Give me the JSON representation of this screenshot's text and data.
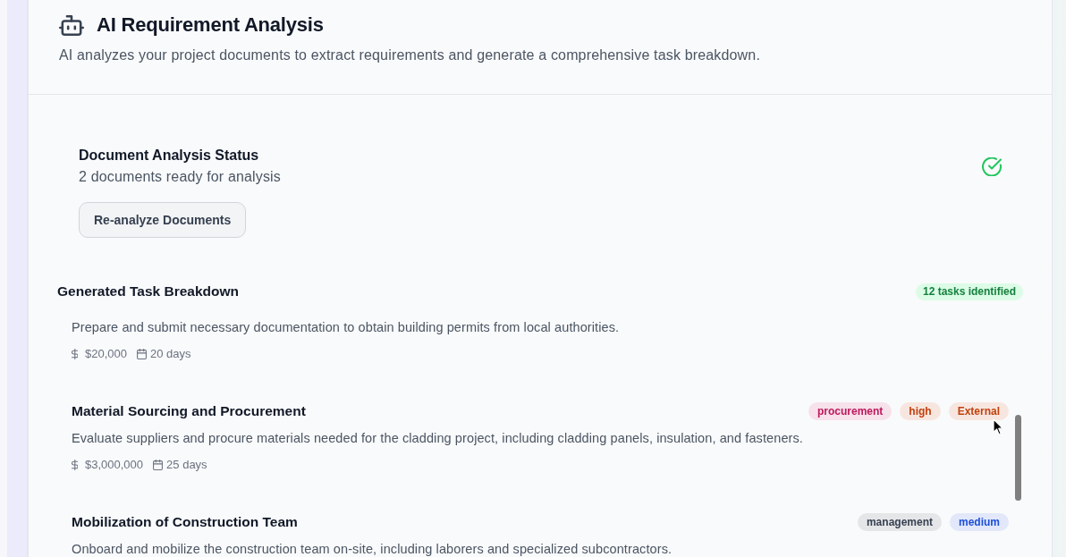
{
  "header": {
    "title": "AI Requirement Analysis",
    "description": "AI analyzes your project documents to extract requirements and generate a comprehensive task breakdown."
  },
  "analysis_status": {
    "title": "Document Analysis Status",
    "subtitle": "2 documents ready for analysis",
    "complete": true,
    "button": "Re-analyze Documents"
  },
  "task_breakdown": {
    "title": "Generated Task Breakdown",
    "badge": "12 tasks identified",
    "tasks": [
      {
        "description": "Prepare and submit necessary documentation to obtain building permits from local authorities.",
        "cost": "$20,000",
        "duration": "20 days"
      },
      {
        "title": "Material Sourcing and Procurement",
        "tags": [
          {
            "label": "procurement",
            "color": "#be185d"
          },
          {
            "label": "high",
            "color": "#c2410c"
          },
          {
            "label": "External",
            "color": "#c2410c"
          }
        ],
        "description": "Evaluate suppliers and procure materials needed for the cladding project, including cladding panels, insulation, and fasteners.",
        "cost": "$3,000,000",
        "duration": "25 days"
      },
      {
        "title": "Mobilization of Construction Team",
        "tags": [
          {
            "label": "management",
            "color": "#374151"
          },
          {
            "label": "medium",
            "color": "#1d4ed8"
          }
        ],
        "description": "Onboard and mobilize the construction team on-site, including laborers and specialized subcontractors."
      }
    ]
  }
}
